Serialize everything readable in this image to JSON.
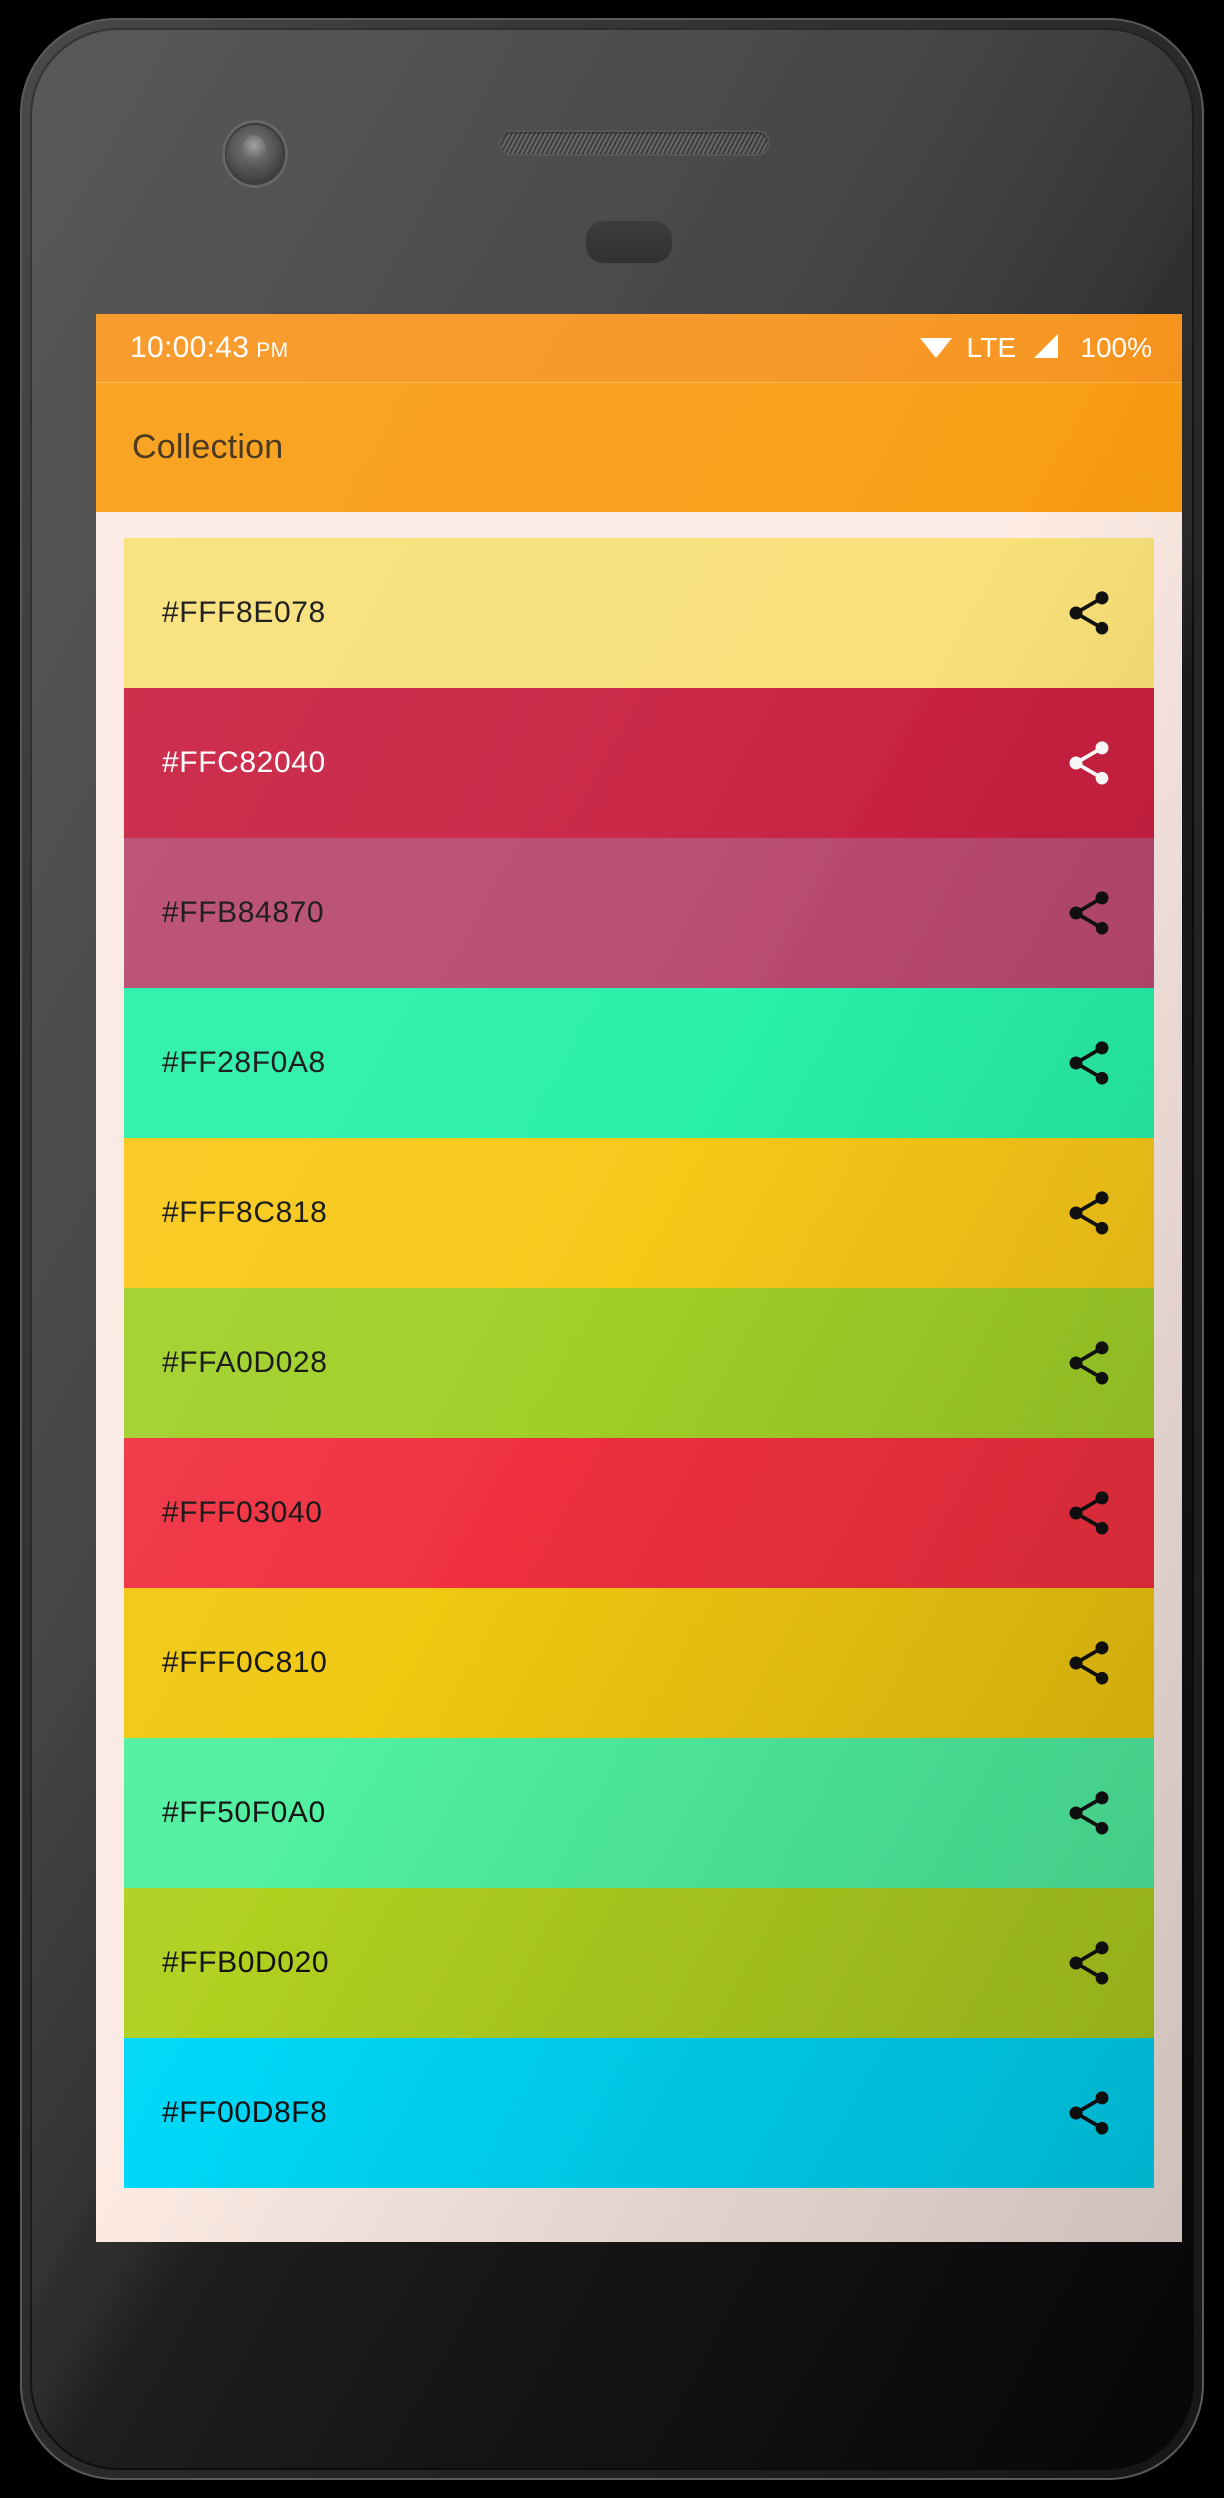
{
  "device": {
    "camera_icon": "front-camera",
    "speaker_icon": "earpiece-speaker",
    "sensor_icon": "proximity-sensor"
  },
  "statusbar": {
    "time": "10:00:43",
    "ampm": "PM",
    "wifi_icon": "wifi-icon",
    "network_label": "LTE",
    "signal_icon": "signal-icon",
    "battery": "100%",
    "background": "#F7941E",
    "foreground": "#FFFFFF"
  },
  "appbar": {
    "title": "Collection",
    "background": "#F99D12",
    "title_color": "#3D2A10"
  },
  "screen": {
    "background": "#FCEAE3"
  },
  "list": {
    "share_icon": "share-icon",
    "items": [
      {
        "hex": "#FFF8E078",
        "swatch": "#F8E078",
        "text_color": "#111111",
        "share_color": "#111111"
      },
      {
        "hex": "#FFC82040",
        "swatch": "#C82040",
        "text_color": "#FFFFFF",
        "share_color": "#FFFFFF"
      },
      {
        "hex": "#FFB84870",
        "swatch": "#B84870",
        "text_color": "#111111",
        "share_color": "#111111"
      },
      {
        "hex": "#FF28F0A8",
        "swatch": "#28F0A8",
        "text_color": "#111111",
        "share_color": "#111111"
      },
      {
        "hex": "#FFF8C818",
        "swatch": "#F8C818",
        "text_color": "#111111",
        "share_color": "#111111"
      },
      {
        "hex": "#FFA0D028",
        "swatch": "#A0D028",
        "text_color": "#111111",
        "share_color": "#111111"
      },
      {
        "hex": "#FFF03040",
        "swatch": "#F03040",
        "text_color": "#111111",
        "share_color": "#111111"
      },
      {
        "hex": "#FFF0C810",
        "swatch": "#F0C810",
        "text_color": "#111111",
        "share_color": "#111111"
      },
      {
        "hex": "#FF50F0A0",
        "swatch": "#50F0A0",
        "text_color": "#111111",
        "share_color": "#111111"
      },
      {
        "hex": "#FFB0D020",
        "swatch": "#B0D020",
        "text_color": "#111111",
        "share_color": "#111111"
      },
      {
        "hex": "#FF00D8F8",
        "swatch": "#00D8F8",
        "text_color": "#111111",
        "share_color": "#111111"
      }
    ]
  }
}
